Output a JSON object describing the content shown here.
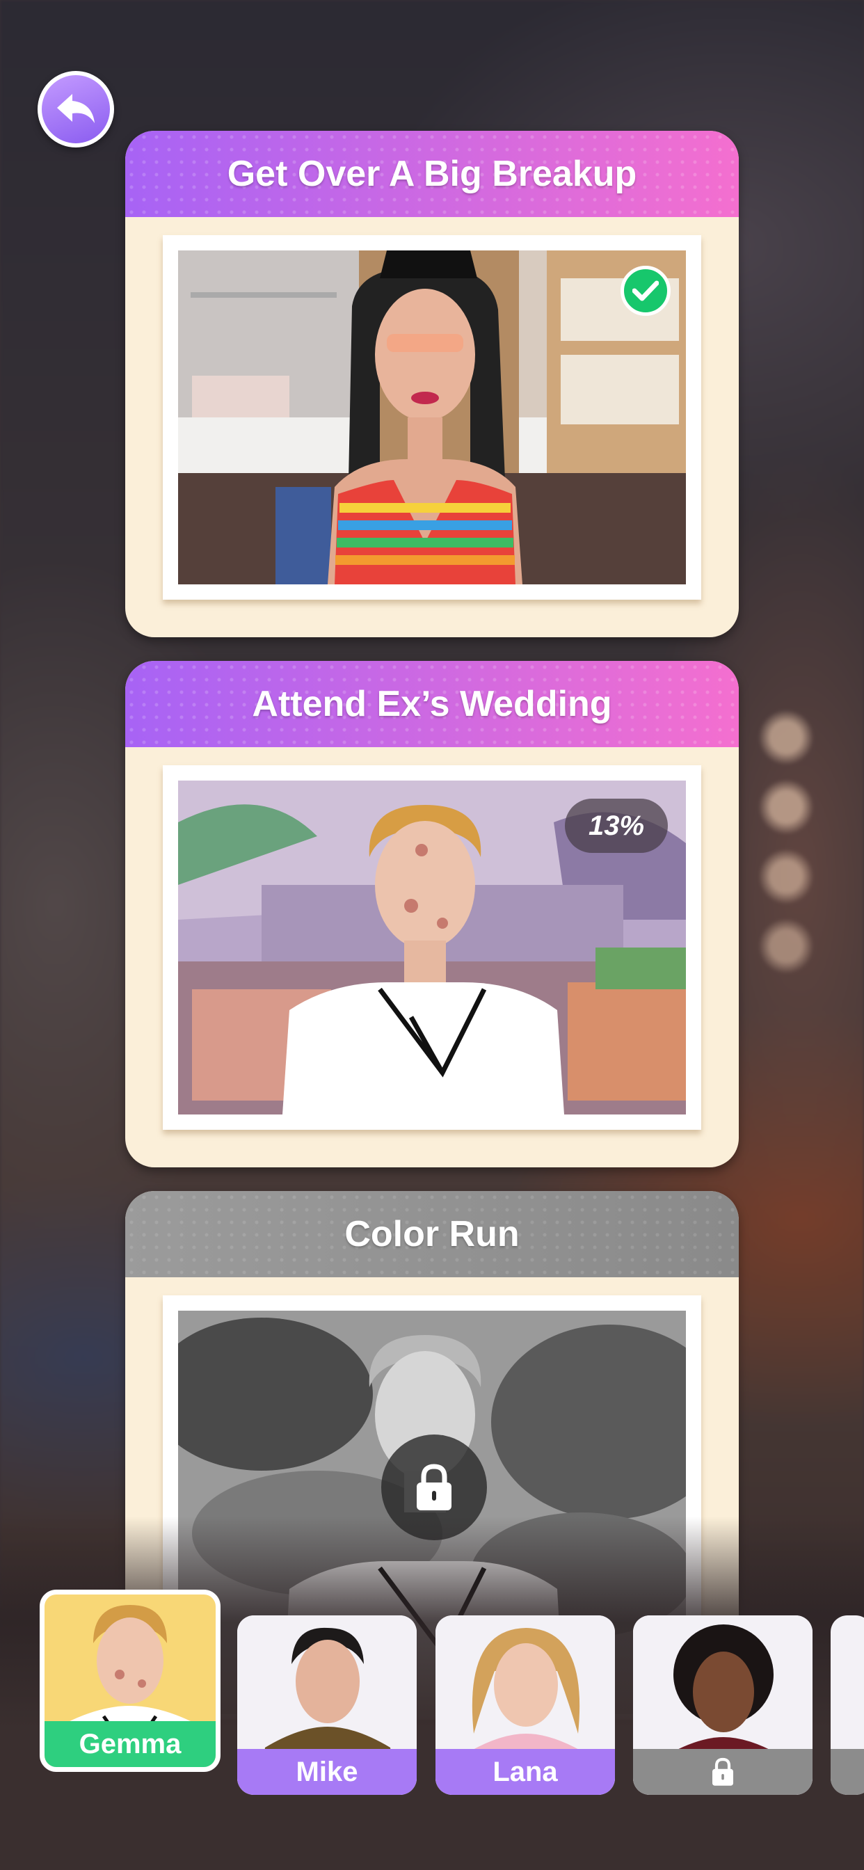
{
  "header": {
    "back_icon": "back-arrow-icon"
  },
  "levels": [
    {
      "title": "Get Over A Big Breakup",
      "status": "completed",
      "badge_icon": "checkmark-icon"
    },
    {
      "title": "Attend Ex’s Wedding",
      "status": "in-progress",
      "progress": "13%"
    },
    {
      "title": "Color Run",
      "status": "locked",
      "lock_icon": "lock-icon"
    }
  ],
  "characters": [
    {
      "name": "Gemma",
      "selected": true,
      "label_color": "#2ecf7f"
    },
    {
      "name": "Mike",
      "selected": false,
      "label_color": "#a77af5"
    },
    {
      "name": "Lana",
      "selected": false,
      "label_color": "#a77af5"
    },
    {
      "name": "",
      "locked": true,
      "label_color": "#8c8c8c",
      "icon": "lock-icon"
    }
  ],
  "colors": {
    "accent_start": "#a763f5",
    "accent_end": "#f46fcf",
    "card_bg": "#fbefd9",
    "success": "#17c76c"
  }
}
